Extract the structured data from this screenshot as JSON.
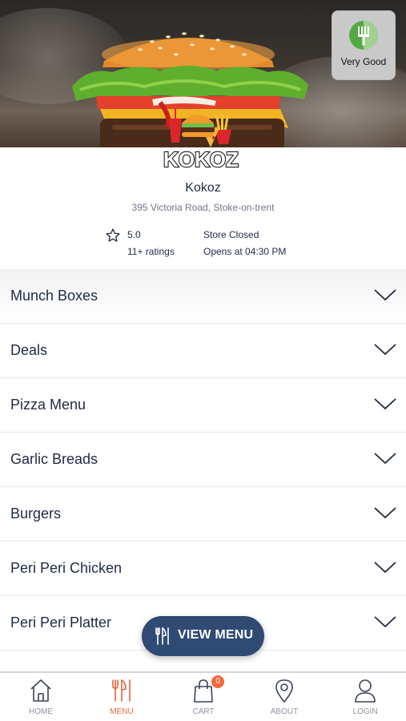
{
  "hero": {
    "badge_label": "Very Good"
  },
  "logo": {
    "text": "KOKOZ"
  },
  "store": {
    "name": "Kokoz",
    "address": "395 Victoria Road, Stoke-on-trent",
    "rating": "5.0",
    "rating_count": "11+ ratings",
    "status": "Store Closed",
    "opens_at": "Opens at 04:30 PM"
  },
  "menu": {
    "items": [
      {
        "label": "Munch Boxes"
      },
      {
        "label": "Deals"
      },
      {
        "label": "Pizza Menu"
      },
      {
        "label": "Garlic Breads"
      },
      {
        "label": "Burgers"
      },
      {
        "label": "Peri Peri Chicken"
      },
      {
        "label": "Peri Peri Platter"
      }
    ]
  },
  "view_menu": {
    "label": "VIEW MENU"
  },
  "nav": {
    "home": "HOME",
    "menu": "MENU",
    "cart": "CART",
    "cart_count": "0",
    "about": "ABOUT",
    "login": "LOGIN"
  },
  "colors": {
    "accent": "#e8643c",
    "primary_button": "#2f4a73",
    "text": "#1f2a44",
    "badge_green": "#55a945"
  },
  "icons": {
    "rating_badge": "fork-icon",
    "rating": "star-icon",
    "accordion": "chevron-down-icon",
    "view_menu": "cutlery-icon",
    "nav_home": "home-icon",
    "nav_menu": "cutlery-icon",
    "nav_cart": "shopping-bag-icon",
    "nav_about": "location-pin-icon",
    "nav_login": "user-icon"
  }
}
